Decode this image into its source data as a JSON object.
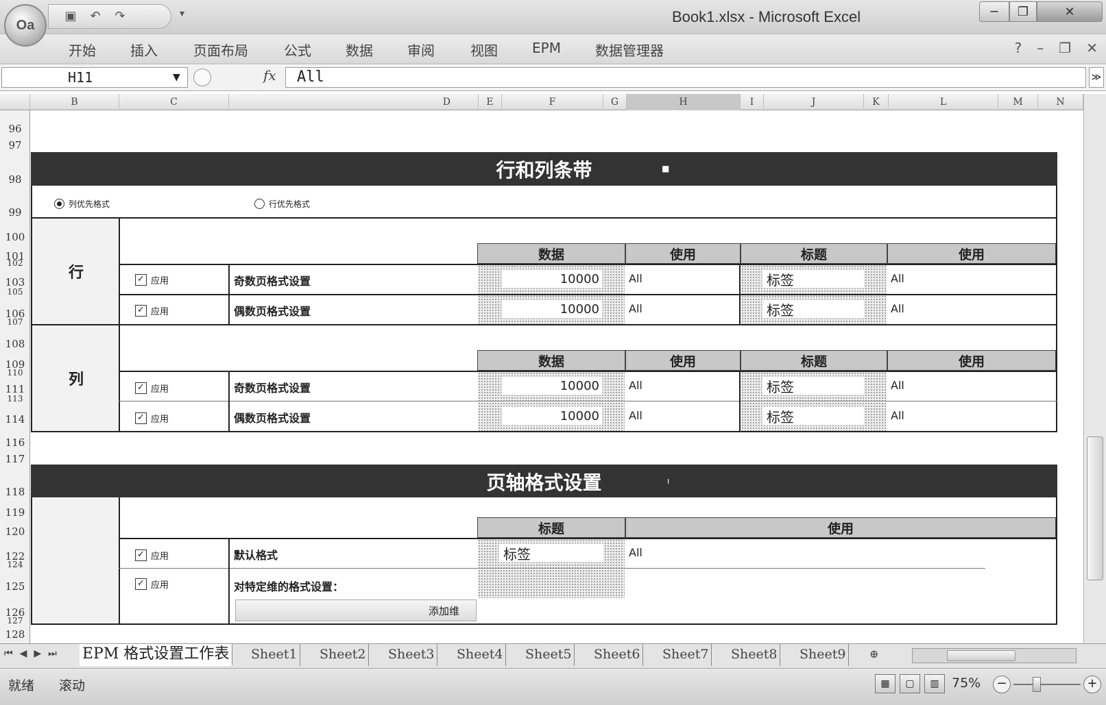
{
  "window": {
    "title": "Book1.xlsx - Microsoft Excel",
    "minimize": "─",
    "maximize": "❐",
    "close": "✕"
  },
  "office_button": "Oa",
  "qat": {
    "save": "▣",
    "undo": "↶",
    "redo": "↷",
    "more": "▾"
  },
  "ribbon": {
    "tabs": [
      "开始",
      "插入",
      "页面布局",
      "公式",
      "数据",
      "审阅",
      "视图",
      "EPM",
      "数据管理器"
    ],
    "right_icons": [
      "?",
      "–",
      "❐",
      "✕"
    ]
  },
  "formula_bar": {
    "name_box": "H11",
    "fx": "fx",
    "value": "All",
    "expand": "≫"
  },
  "columns": [
    "B",
    "C",
    "D",
    "E",
    "F",
    "G",
    "H",
    "I",
    "J",
    "K",
    "L",
    "M",
    "N"
  ],
  "rows": [
    "96",
    "97",
    "98",
    "99",
    "100",
    "101",
    "102",
    "103",
    "105",
    "106",
    "107",
    "108",
    "109",
    "110",
    "111",
    "113",
    "114",
    "116",
    "117",
    "118",
    "119",
    "120",
    "122",
    "124",
    "125",
    "126",
    "127",
    "128"
  ],
  "band1": {
    "title": "行和列条带",
    "marker": "■"
  },
  "radios": {
    "col_first": "列优先格式",
    "row_first": "行优先格式"
  },
  "headers": {
    "data": "数据",
    "use": "使用",
    "title": "标题"
  },
  "row_section": {
    "label": "行",
    "items": [
      {
        "check": "应用",
        "name": "奇数页格式设置",
        "data": "10000",
        "use1": "All",
        "title": "标签",
        "use2": "All"
      },
      {
        "check": "应用",
        "name": "偶数页格式设置",
        "data": "10000",
        "use1": "All",
        "title": "标签",
        "use2": "All"
      }
    ]
  },
  "col_section": {
    "label": "列",
    "items": [
      {
        "check": "应用",
        "name": "奇数页格式设置",
        "data": "10000",
        "use1": "All",
        "title": "标签",
        "use2": "All"
      },
      {
        "check": "应用",
        "name": "偶数页格式设置",
        "data": "10000",
        "use1": "All",
        "title": "标签",
        "use2": "All"
      }
    ]
  },
  "band2": {
    "title": "页轴格式设置",
    "marker": "ı"
  },
  "page_axis": {
    "items": [
      {
        "check": "应用",
        "name": "默认格式",
        "title": "标签",
        "use": "All"
      },
      {
        "check": "应用",
        "name": "对特定维的格式设置："
      }
    ],
    "add_button": "添加维"
  },
  "sheet_tabs": [
    "EPM 格式设置工作表",
    "Sheet1",
    "Sheet2",
    "Sheet3",
    "Sheet4",
    "Sheet5",
    "Sheet6",
    "Sheet7",
    "Sheet8",
    "Sheet9"
  ],
  "tab_nav": [
    "⏮",
    "◀",
    "▶",
    "⏭"
  ],
  "status": {
    "ready": "就绪",
    "scroll": "滚动",
    "zoom": "75%"
  }
}
